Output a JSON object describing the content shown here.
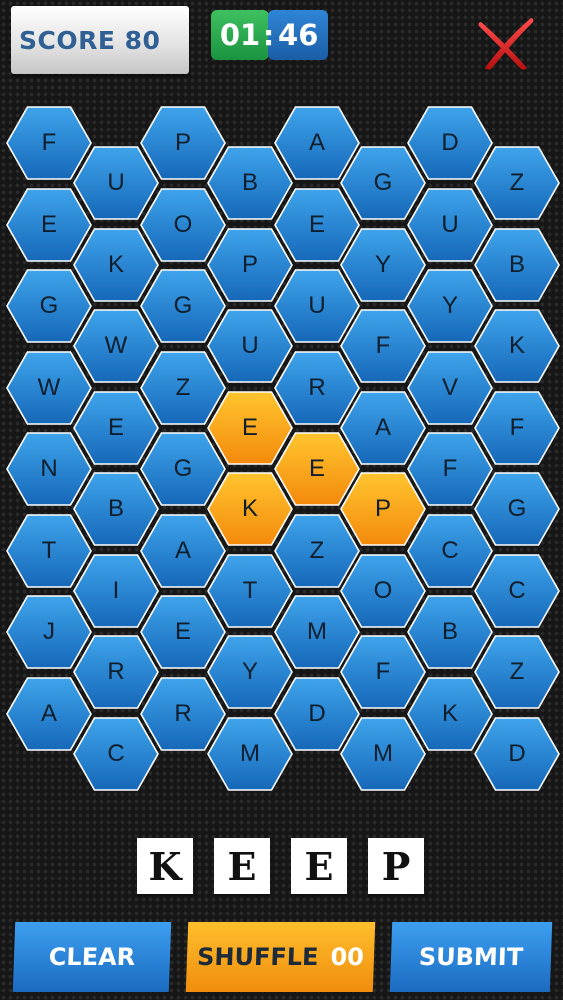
{
  "header": {
    "score_label": "SCORE 80",
    "timer_minutes": "01",
    "timer_separator": ":",
    "timer_seconds": "46"
  },
  "board": {
    "columns": [
      [
        "F",
        "E",
        "G",
        "W",
        "N",
        "T",
        "J",
        "A"
      ],
      [
        "U",
        "K",
        "W",
        "E",
        "B",
        "I",
        "R",
        "C"
      ],
      [
        "P",
        "O",
        "G",
        "Z",
        "G",
        "A",
        "E",
        "R"
      ],
      [
        "B",
        "P",
        "U",
        "E",
        "K",
        "T",
        "Y",
        "M"
      ],
      [
        "A",
        "E",
        "U",
        "R",
        "E",
        "Z",
        "M",
        "D"
      ],
      [
        "G",
        "Y",
        "F",
        "A",
        "P",
        "O",
        "F",
        "M"
      ],
      [
        "D",
        "U",
        "Y",
        "V",
        "F",
        "C",
        "B",
        "K"
      ],
      [
        "Z",
        "B",
        "K",
        "F",
        "G",
        "C",
        "Z",
        "D"
      ]
    ],
    "selected": [
      [
        3,
        3
      ],
      [
        4,
        4
      ],
      [
        3,
        4
      ],
      [
        5,
        4
      ]
    ]
  },
  "word_tiles": [
    "K",
    "E",
    "E",
    "P"
  ],
  "buttons": {
    "clear_label": "CLEAR",
    "shuffle_label": "SHUFFLE",
    "shuffle_count": "00",
    "submit_label": "SUBMIT"
  },
  "colors": {
    "hex_blue_top": "#3fa4ec",
    "hex_blue_bottom": "#1668b8",
    "hex_orange_top": "#ffc52e",
    "hex_orange_bottom": "#f48a0c",
    "hex_border": "#ffffff"
  },
  "icons": {
    "close": "close-x-icon"
  }
}
